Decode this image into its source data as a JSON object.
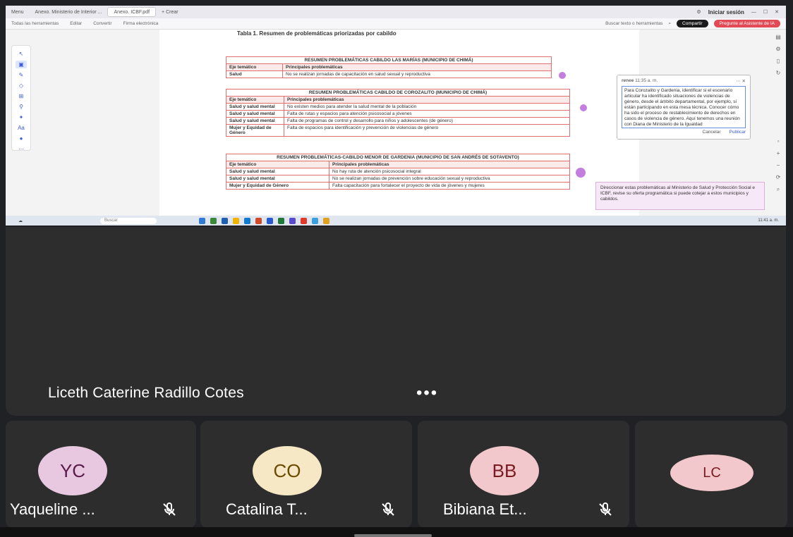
{
  "browser": {
    "tabs": [
      "Menu",
      "Anexo. Ministerio de Interior ...",
      "Anexo. ICBF.pdf",
      "+ Crear"
    ],
    "signin": "Iniciar sesión"
  },
  "toolbar": {
    "items": [
      "Todas las herramientas",
      "Editar",
      "Convertir",
      "Firma electrónica"
    ],
    "search_text": "Buscar texto o herramientas",
    "share": "Compartir",
    "ask_ai": "Pregunte al Asistente de IA"
  },
  "doc": {
    "heading": "Tabla 1. Resumen de problemáticas priorizadas por cabildo",
    "tables": [
      {
        "caption": "RESUMEN PROBLEMÁTICAS CABILDO LAS MARÍAS (MUNICIPIO DE CHIMÁ)",
        "col1": "Eje temático",
        "col2": "Principales problemáticas",
        "rows": [
          {
            "eje": "Salud",
            "prob": "No se realizan jornadas de capacitación en salud sexual y reproductiva"
          }
        ]
      },
      {
        "caption": "RESUMEN PROBLEMÁTICAS CABILDO DE COROZALITO (MUNICIPIO DE CHIMÁ)",
        "col1": "Eje temático",
        "col2": "Principales problemáticas",
        "rows": [
          {
            "eje": "Salud y salud mental",
            "prob": "No existen medios para atender la salud mental de la población"
          },
          {
            "eje": "Salud y salud mental",
            "prob": "Falta de rutas y espacios para atención psicosocial a jóvenes"
          },
          {
            "eje": "Salud y salud mental",
            "prob": "Falta de programas de control y desarrollo para niños y adolescentes (de género)"
          },
          {
            "eje": "Mujer y Equidad de Género",
            "prob": "Falta de espacios para identificación y prevención de violencias de género"
          }
        ]
      },
      {
        "caption": "RESUMEN PROBLEMÁTICAS-CABILDO MENOR DE GARDENIA (MUNICIPIO DE SAN ANDRÉS DE SOTAVENTO)",
        "col1": "Eje temático",
        "col2": "Principales problemáticas",
        "rows": [
          {
            "eje": "Salud y salud mental",
            "prob": "No hay ruta de atención psicosocial integral"
          },
          {
            "eje": "Salud y salud mental",
            "prob": "No se realizan jornadas de prevención sobre educación sexual y reproductiva"
          },
          {
            "eje": "Mujer y Equidad de Género",
            "prob": "Falta capacitación para fortalecer el proyecto de vida de jóvenes y mujeres"
          }
        ]
      }
    ]
  },
  "comment": {
    "author": "renee",
    "time": "11:35 a. m.",
    "body": "Para Corozalito y Gardenia, identificar si el escenario articular ha identificado situaciones de violencias de género, desde el ámbito departamental, por ejemplo, si están participando en esta mesa técnica. Conocer cómo ha sido el proceso de restablecimiento de derechos en casos de violencia de género. Aquí tenemos una reunión con Diana de Ministerio de la Igualdad",
    "cancel": "Cancelar",
    "publish": "Publicar"
  },
  "note": {
    "text": "Direccionar estas problemáticas al Ministerio de Salud y Protección Social e ICBF, revise su oferta programática si puede cotejar a estos municipios y cabildos."
  },
  "taskbar": {
    "search": "Buscar",
    "clock": "11:41 a. m."
  },
  "meeting": {
    "speaker": "Liceth Caterine Radillo Cotes",
    "more": "•••",
    "participants": [
      {
        "initials": "YC",
        "name": "Yaqueline ...",
        "bg": "#e8c8e0",
        "fg": "#5a1a4a"
      },
      {
        "initials": "CO",
        "name": "Catalina T...",
        "bg": "#f6e8c4",
        "fg": "#6a4a00"
      },
      {
        "initials": "BB",
        "name": "Bibiana Et...",
        "bg": "#f2c8cc",
        "fg": "#7a1a22"
      },
      {
        "initials": "LC",
        "name": "",
        "bg": "#f2c8cc",
        "fg": "#7a1a22"
      }
    ]
  }
}
